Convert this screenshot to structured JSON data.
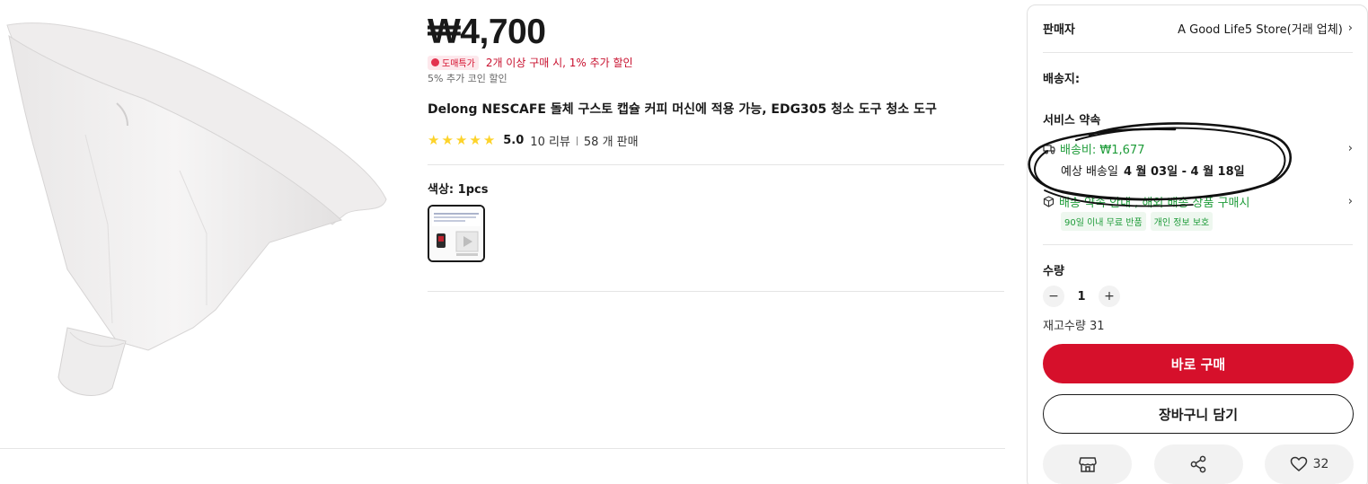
{
  "product": {
    "price": "₩4,700",
    "promo_badge": "도매특가",
    "promo_text": "2개 이상 구매 시, 1% 추가 할인",
    "coin_text": "5% 추가 코인 할인",
    "title": "Delong NESCAFE 돌체 구스토 캡슐 커피 머신에 적용 가능, EDG305 청소 도구 청소 도구",
    "rating": "5.0",
    "reviews": "10 리뷰",
    "sold": "58 개 판매",
    "color_label": "색상: 1pcs"
  },
  "panel": {
    "seller_label": "판매자",
    "seller_name": "A Good Life5 Store(거래 업체)",
    "shipping_to_label": "배송지:",
    "service_label": "서비스 약속",
    "shipping_fee": "배송비: ₩1,677",
    "estimated_label": "예상 배송일",
    "estimated_dates": "4 월 03일 - 4 월 18일",
    "guarantee": "배송 약속 안내 , 해외 배송 상품 구매시",
    "badges": [
      "90일 이내 무료 반품",
      "개인 정보 보호"
    ],
    "quantity_label": "수량",
    "quantity": "1",
    "stock": "재고수량 31",
    "buy_now": "바로 구매",
    "add_to_cart": "장바구니 담기",
    "wishlist_count": "32"
  },
  "icons": {
    "store": "store-icon",
    "share": "share-icon",
    "heart": "heart-icon",
    "truck": "truck-icon",
    "shield": "shield-icon",
    "chevron": "chevron-right-icon"
  },
  "colors": {
    "primary": "#d6102b",
    "green": "#1f9c3a",
    "star": "#fdd32a"
  }
}
